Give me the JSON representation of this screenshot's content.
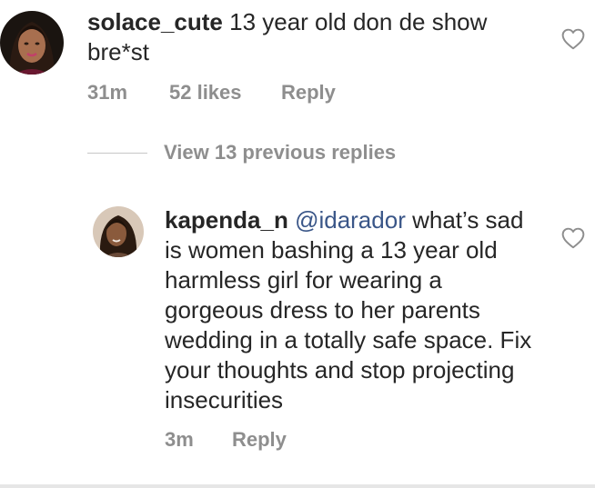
{
  "comment": {
    "username": "solace_cute",
    "text": "13 year old don de show bre*st",
    "time": "31m",
    "likes": "52 likes",
    "reply_label": "Reply"
  },
  "view_replies_label": "View 13 previous replies",
  "reply": {
    "username": "kapenda_n",
    "mention": "@idarador",
    "text": "what’s sad is women bashing a 13 year old harmless girl for wearing a gorgeous dress to her parents wedding in a totally safe space. Fix your thoughts and stop projecting insecurities",
    "time": "3m",
    "reply_label": "Reply"
  },
  "icons": {
    "like": "heart-outline-icon"
  }
}
